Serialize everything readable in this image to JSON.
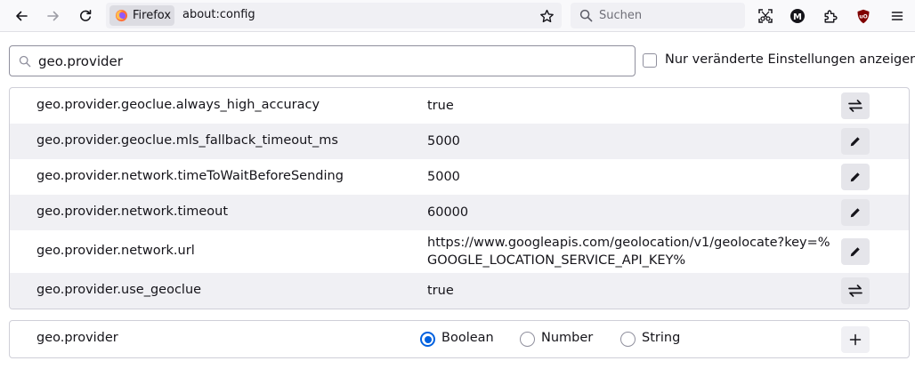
{
  "toolbar": {
    "back_icon": "arrow-left-icon",
    "forward_icon": "arrow-right-icon",
    "reload_icon": "reload-icon",
    "identity_label": "Firefox",
    "url": "about:config",
    "bookmark_icon": "star-icon",
    "search_placeholder": "Suchen",
    "extensions": [
      "screenshot-icon",
      "m-extension-icon",
      "puzzle-icon",
      "ublock-icon"
    ],
    "menu_icon": "hamburger-icon"
  },
  "config": {
    "filter_value": "geo.provider",
    "modified_only_label": "Nur veränderte Einstellungen anzeigen",
    "modified_only_checked": false,
    "prefs": [
      {
        "name": "geo.provider.geoclue.always_high_accuracy",
        "value": "true",
        "action": "toggle"
      },
      {
        "name": "geo.provider.geoclue.mls_fallback_timeout_ms",
        "value": "5000",
        "action": "edit"
      },
      {
        "name": "geo.provider.network.timeToWaitBeforeSending",
        "value": "5000",
        "action": "edit"
      },
      {
        "name": "geo.provider.network.timeout",
        "value": "60000",
        "action": "edit"
      },
      {
        "name": "geo.provider.network.url",
        "value": "https://www.googleapis.com/geolocation/v1/geolocate?key=%GOOGLE_LOCATION_SERVICE_API_KEY%",
        "action": "edit"
      },
      {
        "name": "geo.provider.use_geoclue",
        "value": "true",
        "action": "toggle"
      }
    ],
    "new_pref": {
      "name": "geo.provider",
      "types": [
        "Boolean",
        "Number",
        "String"
      ],
      "selected_type": "Boolean"
    }
  },
  "colors": {
    "accent": "#0061e0",
    "row_alt": "#f0f0f4",
    "toolbar_bg": "#f9f9fb"
  }
}
